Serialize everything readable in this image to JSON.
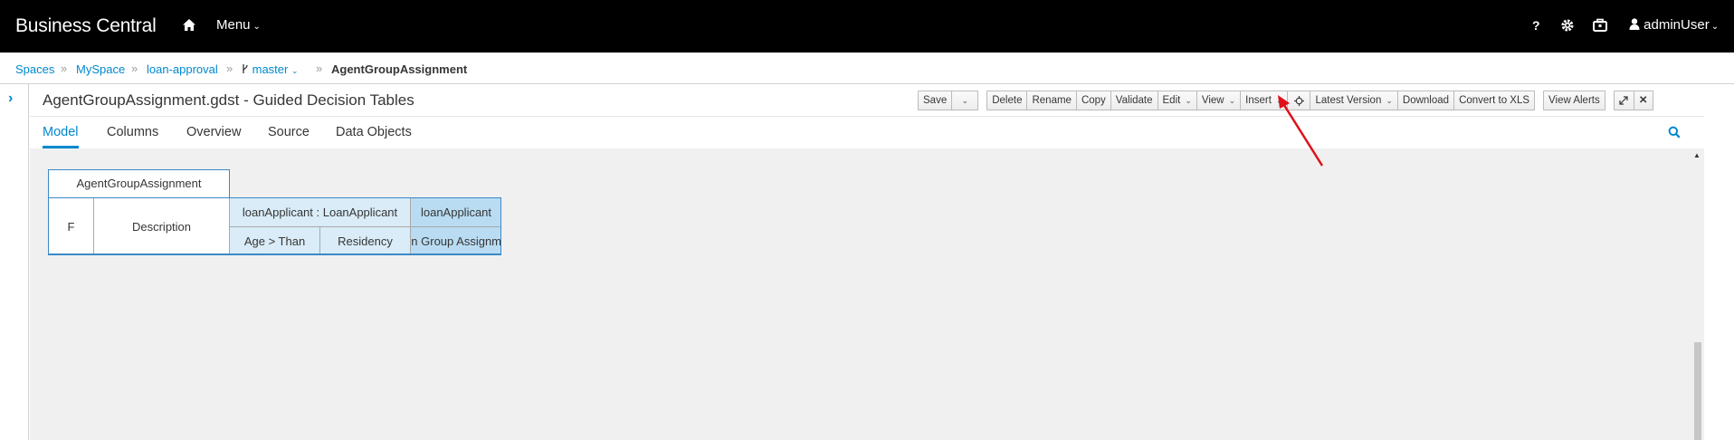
{
  "topbar": {
    "brand": "Business Central",
    "menu_label": "Menu",
    "user_label": "adminUser",
    "icons": [
      "home-icon",
      "help-icon",
      "gear-icon",
      "briefcase-icon",
      "user-icon"
    ]
  },
  "breadcrumb": {
    "items": [
      "Spaces",
      "MySpace",
      "loan-approval",
      "master",
      "AgentGroupAssignment"
    ]
  },
  "editor": {
    "title": "AgentGroupAssignment.gdst - Guided Decision Tables"
  },
  "toolbar": {
    "save": "Save",
    "delete": "Delete",
    "rename": "Rename",
    "copy": "Copy",
    "validate": "Validate",
    "edit": "Edit",
    "view": "View",
    "insert": "Insert",
    "latest_version": "Latest Version",
    "download": "Download",
    "convert": "Convert to XLS",
    "view_alerts": "View Alerts"
  },
  "tabs": [
    "Model",
    "Columns",
    "Overview",
    "Source",
    "Data Objects"
  ],
  "decision_table": {
    "name": "AgentGroupAssignment",
    "col_f": "F",
    "col_description": "Description",
    "condition_header": "loanApplicant : LoanApplicant",
    "condition_col1": "Age > Than",
    "condition_col2": "Residency",
    "action_header": "loanApplicant",
    "action_col": "n Group Assignm"
  },
  "colors": {
    "accent": "#0088ce",
    "topbar_bg": "#000000",
    "condition_cell": "#d9ecf8",
    "action_cell": "#b9dcf3",
    "annotation_arrow": "#e0101a"
  }
}
